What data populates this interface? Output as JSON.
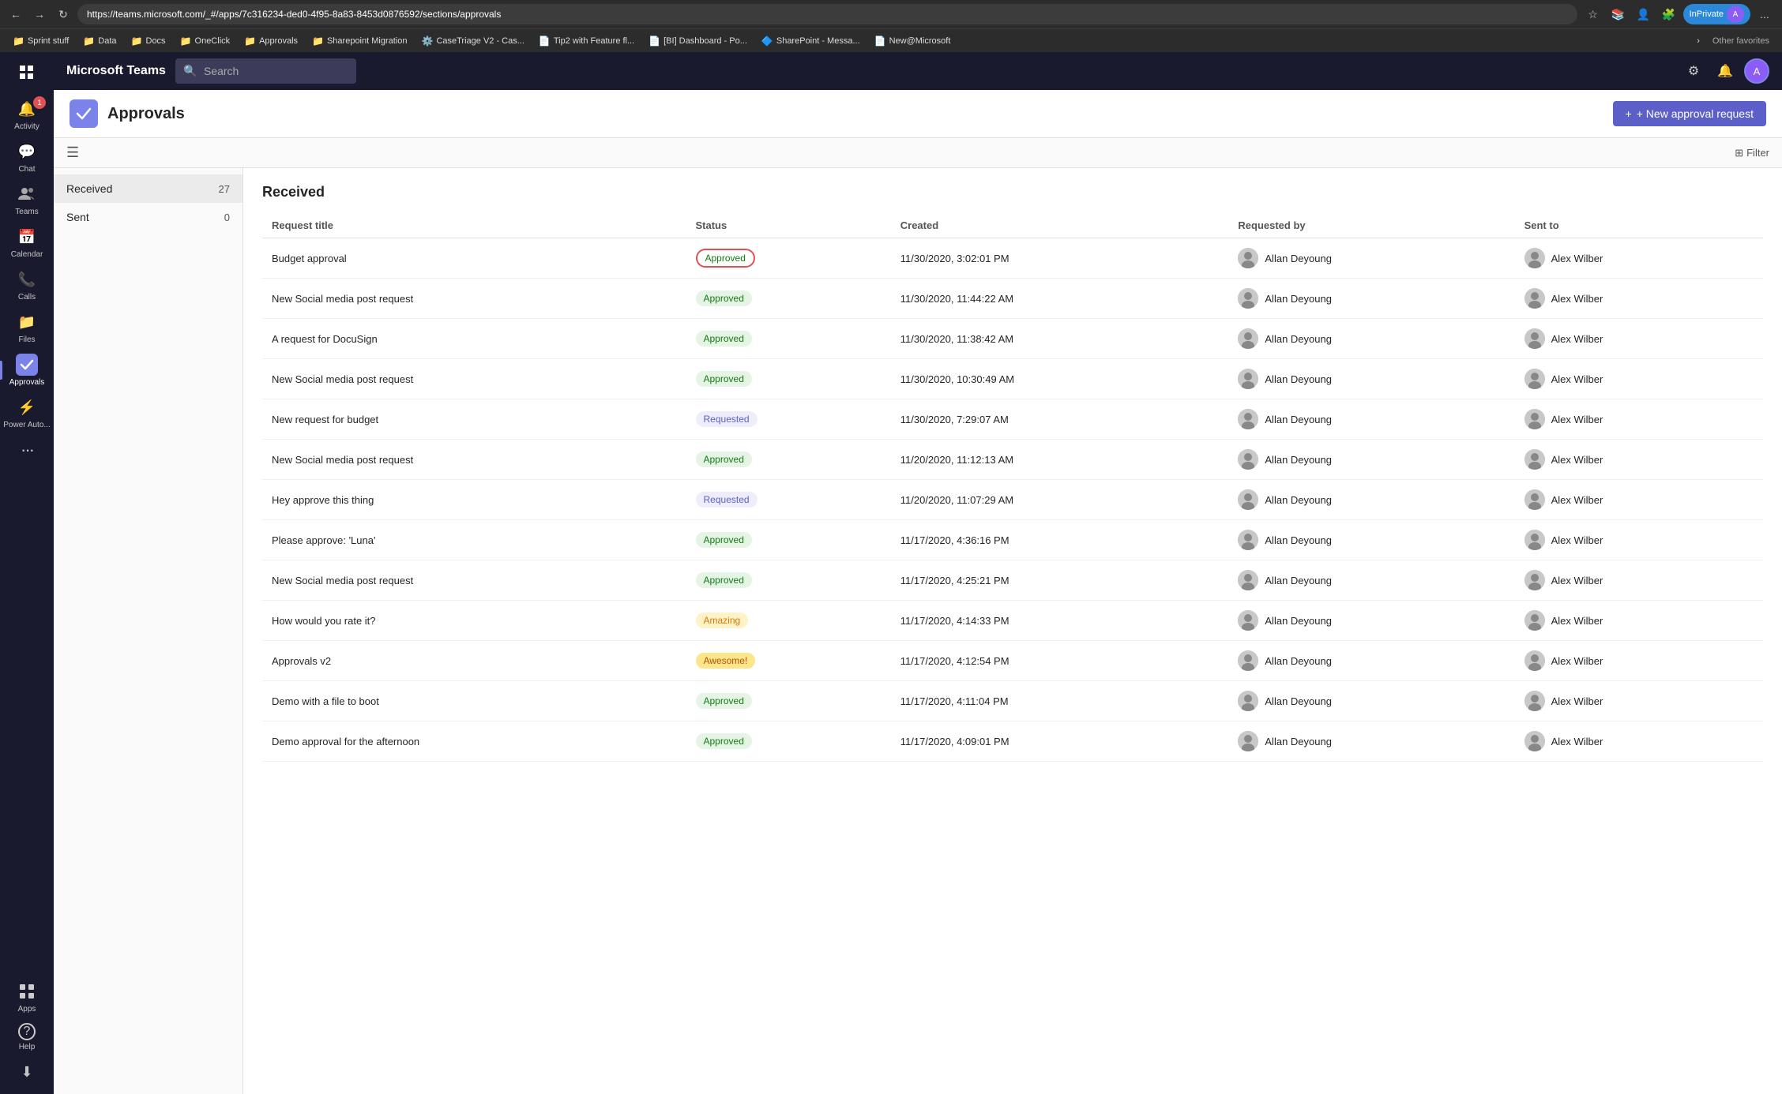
{
  "browser": {
    "url": "https://teams.microsoft.com/_#/apps/7c316234-ded0-4f95-8a83-8453d0876592/sections/approvals",
    "back_btn": "←",
    "forward_btn": "→",
    "refresh_btn": "↻",
    "inprivate_label": "InPrivate",
    "more_label": "...",
    "bookmarks": [
      {
        "label": "Sprint stuff",
        "icon": "📁"
      },
      {
        "label": "Data",
        "icon": "📁"
      },
      {
        "label": "Docs",
        "icon": "📁"
      },
      {
        "label": "OneClick",
        "icon": "📁"
      },
      {
        "label": "Approvals",
        "icon": "📁"
      },
      {
        "label": "Sharepoint Migration",
        "icon": "📁"
      },
      {
        "label": "CaseTriage V2 - Cas...",
        "icon": "⚙️"
      },
      {
        "label": "Tip2 with Feature fl...",
        "icon": "📄"
      },
      {
        "label": "[BI] Dashboard - Po...",
        "icon": "📄"
      },
      {
        "label": "SharePoint - Messa...",
        "icon": "🔷"
      },
      {
        "label": "New@Microsoft",
        "icon": "📄"
      }
    ],
    "other_favorites": "Other favorites",
    "more_bookmarks": "›"
  },
  "teams": {
    "app_title": "Microsoft Teams",
    "search_placeholder": "Search",
    "sidebar": [
      {
        "id": "activity",
        "label": "Activity",
        "icon": "🔔",
        "active": false,
        "badge": "1"
      },
      {
        "id": "chat",
        "label": "Chat",
        "icon": "💬",
        "active": false
      },
      {
        "id": "teams",
        "label": "Teams",
        "icon": "👥",
        "active": false
      },
      {
        "id": "calendar",
        "label": "Calendar",
        "icon": "📅",
        "active": false
      },
      {
        "id": "calls",
        "label": "Calls",
        "icon": "📞",
        "active": false
      },
      {
        "id": "files",
        "label": "Files",
        "icon": "📁",
        "active": false
      },
      {
        "id": "approvals",
        "label": "Approvals",
        "icon": "✓",
        "active": true
      },
      {
        "id": "power-automate",
        "label": "Power Auto...",
        "icon": "⚡",
        "active": false
      },
      {
        "id": "more",
        "label": "...",
        "icon": "···",
        "active": false
      }
    ],
    "sidebar_bottom": [
      {
        "id": "apps",
        "label": "Apps",
        "icon": "⊞"
      },
      {
        "id": "help",
        "label": "Help",
        "icon": "?"
      },
      {
        "id": "download",
        "label": "",
        "icon": "⬇"
      }
    ]
  },
  "approvals": {
    "title": "Approvals",
    "new_request_btn": "+ New approval request",
    "filter_btn": "Filter",
    "nav": [
      {
        "id": "received",
        "label": "Received",
        "count": "27",
        "active": true
      },
      {
        "id": "sent",
        "label": "Sent",
        "count": "0",
        "active": false
      }
    ],
    "section_title": "Received",
    "columns": [
      {
        "id": "title",
        "label": "Request title"
      },
      {
        "id": "status",
        "label": "Status"
      },
      {
        "id": "created",
        "label": "Created"
      },
      {
        "id": "requested_by",
        "label": "Requested by"
      },
      {
        "id": "sent_to",
        "label": "Sent to"
      }
    ],
    "rows": [
      {
        "title": "Budget approval",
        "status": "Approved",
        "status_type": "approved-bordered",
        "created": "11/30/2020, 3:02:01 PM",
        "requested_by": "Allan Deyoung",
        "sent_to": "Alex Wilber"
      },
      {
        "title": "New Social media post request",
        "status": "Approved",
        "status_type": "approved",
        "created": "11/30/2020, 11:44:22 AM",
        "requested_by": "Allan Deyoung",
        "sent_to": "Alex Wilber"
      },
      {
        "title": "A request for DocuSign",
        "status": "Approved",
        "status_type": "approved",
        "created": "11/30/2020, 11:38:42 AM",
        "requested_by": "Allan Deyoung",
        "sent_to": "Alex Wilber"
      },
      {
        "title": "New Social media post request",
        "status": "Approved",
        "status_type": "approved",
        "created": "11/30/2020, 10:30:49 AM",
        "requested_by": "Allan Deyoung",
        "sent_to": "Alex Wilber"
      },
      {
        "title": "New request for budget",
        "status": "Requested",
        "status_type": "requested",
        "created": "11/30/2020, 7:29:07 AM",
        "requested_by": "Allan Deyoung",
        "sent_to": "Alex Wilber"
      },
      {
        "title": "New Social media post request",
        "status": "Approved",
        "status_type": "approved",
        "created": "11/20/2020, 11:12:13 AM",
        "requested_by": "Allan Deyoung",
        "sent_to": "Alex Wilber"
      },
      {
        "title": "Hey approve this thing",
        "status": "Requested",
        "status_type": "requested",
        "created": "11/20/2020, 11:07:29 AM",
        "requested_by": "Allan Deyoung",
        "sent_to": "Alex Wilber"
      },
      {
        "title": "Please approve: 'Luna'",
        "status": "Approved",
        "status_type": "approved",
        "created": "11/17/2020, 4:36:16 PM",
        "requested_by": "Allan Deyoung",
        "sent_to": "Alex Wilber"
      },
      {
        "title": "New Social media post request",
        "status": "Approved",
        "status_type": "approved",
        "created": "11/17/2020, 4:25:21 PM",
        "requested_by": "Allan Deyoung",
        "sent_to": "Alex Wilber"
      },
      {
        "title": "How would you rate it?",
        "status": "Amazing",
        "status_type": "amazing",
        "created": "11/17/2020, 4:14:33 PM",
        "requested_by": "Allan Deyoung",
        "sent_to": "Alex Wilber"
      },
      {
        "title": "Approvals v2",
        "status": "Awesome!",
        "status_type": "awesome",
        "created": "11/17/2020, 4:12:54 PM",
        "requested_by": "Allan Deyoung",
        "sent_to": "Alex Wilber"
      },
      {
        "title": "Demo with a file to boot",
        "status": "Approved",
        "status_type": "approved",
        "created": "11/17/2020, 4:11:04 PM",
        "requested_by": "Allan Deyoung",
        "sent_to": "Alex Wilber"
      },
      {
        "title": "Demo approval for the afternoon",
        "status": "Approved",
        "status_type": "approved",
        "created": "11/17/2020, 4:09:01 PM",
        "requested_by": "Allan Deyoung",
        "sent_to": "Alex Wilber"
      }
    ]
  }
}
